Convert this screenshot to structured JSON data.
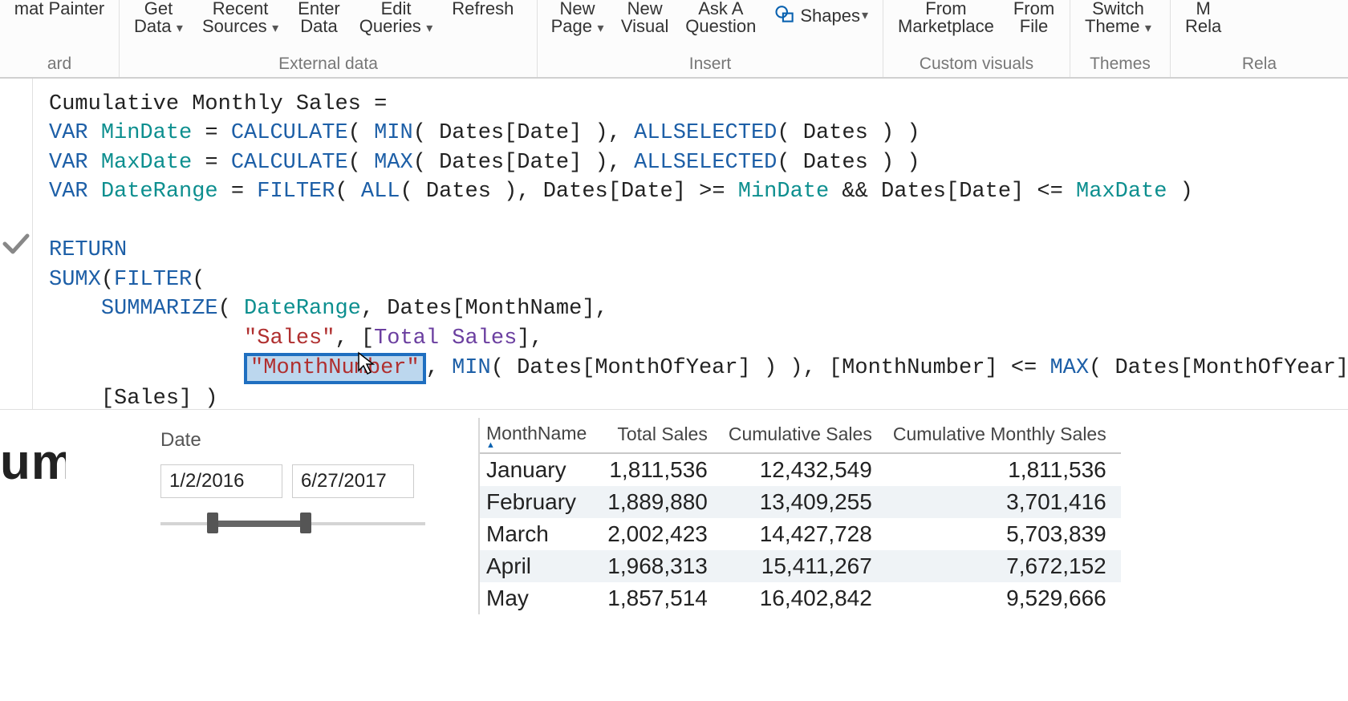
{
  "ribbon": {
    "clipboard_group": "ard",
    "clipboard_btn": "mat Painter",
    "external_group": "External data",
    "get_data": "Get",
    "get_data2": "Data",
    "recent": "Recent",
    "recent2": "Sources",
    "enter": "Enter",
    "enter2": "Data",
    "edit": "Edit",
    "edit2": "Queries",
    "refresh": "Refresh",
    "insert_group": "Insert",
    "new_page": "New",
    "new_page2": "Page",
    "new_visual": "New",
    "new_visual2": "Visual",
    "ask": "Ask A",
    "ask2": "Question",
    "shapes": "Shapes",
    "custom_group": "Custom visuals",
    "marketplace1": "From",
    "marketplace2": "Marketplace",
    "file1": "From",
    "file2": "File",
    "themes_group": "Themes",
    "switch1": "Switch",
    "switch2": "Theme",
    "rel_group": "Rela",
    "rel1": "M",
    "rel2": "Rela"
  },
  "cut_title": "um",
  "formula": {
    "measure_name": "Cumulative Monthly Sales",
    "var_min": "MinDate",
    "var_max": "MaxDate",
    "var_range": "DateRange",
    "fn_calculate": "CALCULATE",
    "fn_min": "MIN",
    "fn_max": "MAX",
    "fn_allselected": "ALLSELECTED",
    "fn_filter": "FILTER",
    "fn_all": "ALL",
    "fn_sumx": "SUMX",
    "fn_summarize": "SUMMARIZE",
    "kw_var": "VAR",
    "kw_return": "RETURN",
    "col_dates_date": "Dates[Date]",
    "col_dates": "Dates",
    "col_monthname": "Dates[MonthName]",
    "col_monthofyear": "Dates[MonthOfYear]",
    "str_sales": "\"Sales\"",
    "str_monthnum": "\"MonthNumber\"",
    "meas_total_sales": "Total Sales",
    "col_monthnumber": "[MonthNumber]",
    "col_sales": "[Sales]"
  },
  "slicer": {
    "title": "Date",
    "from": "1/2/2016",
    "to": "6/27/2017"
  },
  "table": {
    "headers": [
      "MonthName",
      "Total Sales",
      "Cumulative Sales",
      "Cumulative Monthly Sales"
    ],
    "sort_col": 0,
    "rows": [
      [
        "January",
        "1,811,536",
        "12,432,549",
        "1,811,536"
      ],
      [
        "February",
        "1,889,880",
        "13,409,255",
        "3,701,416"
      ],
      [
        "March",
        "2,002,423",
        "14,427,728",
        "5,703,839"
      ],
      [
        "April",
        "1,968,313",
        "15,411,267",
        "7,672,152"
      ],
      [
        "May",
        "1,857,514",
        "16,402,842",
        "9,529,666"
      ]
    ]
  },
  "chart_data": {
    "type": "table",
    "columns": [
      "MonthName",
      "Total Sales",
      "Cumulative Sales",
      "Cumulative Monthly Sales"
    ],
    "rows": [
      {
        "MonthName": "January",
        "Total Sales": 1811536,
        "Cumulative Sales": 12432549,
        "Cumulative Monthly Sales": 1811536
      },
      {
        "MonthName": "February",
        "Total Sales": 1889880,
        "Cumulative Sales": 13409255,
        "Cumulative Monthly Sales": 3701416
      },
      {
        "MonthName": "March",
        "Total Sales": 2002423,
        "Cumulative Sales": 14427728,
        "Cumulative Monthly Sales": 5703839
      },
      {
        "MonthName": "April",
        "Total Sales": 1968313,
        "Cumulative Sales": 15411267,
        "Cumulative Monthly Sales": 7672152
      },
      {
        "MonthName": "May",
        "Total Sales": 1857514,
        "Cumulative Sales": 16402842,
        "Cumulative Monthly Sales": 9529666
      }
    ]
  }
}
